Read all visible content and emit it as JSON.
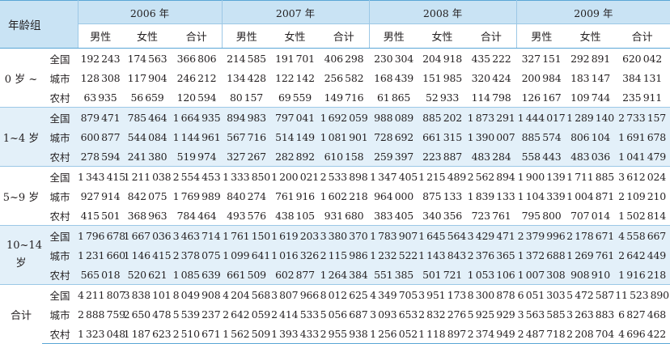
{
  "table": {
    "age_header": "年龄组",
    "years": [
      "2006 年",
      "2007 年",
      "2008 年",
      "2009 年"
    ],
    "sub_headers": [
      "男性",
      "女性",
      "合计"
    ],
    "groups": [
      {
        "age": "0 岁 ~",
        "rows": [
          {
            "region": "全国",
            "values": [
              "192243",
              "174563",
              "366806",
              "214585",
              "191701",
              "406298",
              "230304",
              "204918",
              "435222",
              "327151",
              "292891",
              "620042"
            ]
          },
          {
            "region": "城市",
            "values": [
              "128308",
              "117904",
              "246212",
              "134428",
              "122142",
              "256582",
              "168439",
              "151985",
              "320424",
              "200984",
              "183147",
              "384131"
            ]
          },
          {
            "region": "农村",
            "values": [
              "63935",
              "56659",
              "120594",
              "80157",
              "69559",
              "149716",
              "61865",
              "52933",
              "114798",
              "126167",
              "109744",
              "235911"
            ]
          }
        ]
      },
      {
        "age": "1~4 岁",
        "rows": [
          {
            "region": "全国",
            "values": [
              "879471",
              "785464",
              "1664935",
              "894983",
              "797041",
              "1692059",
              "988089",
              "885202",
              "1873291",
              "1444017",
              "1289140",
              "2733157"
            ]
          },
          {
            "region": "城市",
            "values": [
              "600877",
              "544084",
              "1144961",
              "567716",
              "514149",
              "1081901",
              "728692",
              "661315",
              "1390007",
              "885574",
              "806104",
              "1691678"
            ]
          },
          {
            "region": "农村",
            "values": [
              "278594",
              "241380",
              "519974",
              "327267",
              "282892",
              "610158",
              "259397",
              "223887",
              "483284",
              "558443",
              "483036",
              "1041479"
            ]
          }
        ]
      },
      {
        "age": "5~9 岁",
        "rows": [
          {
            "region": "全国",
            "values": [
              "1343415",
              "1211038",
              "2554453",
              "1333850",
              "1200021",
              "2533898",
              "1347405",
              "1215489",
              "2562894",
              "1900139",
              "1711885",
              "3612024"
            ]
          },
          {
            "region": "城市",
            "values": [
              "927914",
              "842075",
              "1769989",
              "840274",
              "761916",
              "1602218",
              "964000",
              "875133",
              "1839133",
              "1104339",
              "1004871",
              "2109210"
            ]
          },
          {
            "region": "农村",
            "values": [
              "415501",
              "368963",
              "784464",
              "493576",
              "438105",
              "931680",
              "383405",
              "340356",
              "723761",
              "795800",
              "707014",
              "1502814"
            ]
          }
        ]
      },
      {
        "age": "10~14 岁",
        "rows": [
          {
            "region": "全国",
            "values": [
              "1796678",
              "1667036",
              "3463714",
              "1761150",
              "1619203",
              "3380370",
              "1783907",
              "1645564",
              "3429471",
              "2379996",
              "2178671",
              "4558667"
            ]
          },
          {
            "region": "城市",
            "values": [
              "1231660",
              "1146415",
              "2378075",
              "1099641",
              "1016326",
              "2115986",
              "1232522",
              "1143843",
              "2376365",
              "1372688",
              "1269761",
              "2642449"
            ]
          },
          {
            "region": "农村",
            "values": [
              "565018",
              "520621",
              "1085639",
              "661509",
              "602877",
              "1264384",
              "551385",
              "501721",
              "1053106",
              "1007308",
              "908910",
              "1916218"
            ]
          }
        ]
      },
      {
        "age": "合计",
        "rows": [
          {
            "region": "全国",
            "values": [
              "4211807",
              "3838101",
              "8049908",
              "4204568",
              "3807966",
              "8012625",
              "4349705",
              "3951173",
              "8300878",
              "6051303",
              "5472587",
              "11523890"
            ]
          },
          {
            "region": "城市",
            "values": [
              "2888759",
              "2650478",
              "5539237",
              "2642059",
              "2414533",
              "5056687",
              "3093653",
              "2832276",
              "5925929",
              "3563585",
              "3263883",
              "6827468"
            ]
          },
          {
            "region": "农村",
            "values": [
              "1323048",
              "1187623",
              "2510671",
              "1562509",
              "1393433",
              "2955938",
              "1256052",
              "1118897",
              "2374949",
              "2487718",
              "2208704",
              "4696422"
            ]
          }
        ]
      }
    ]
  }
}
